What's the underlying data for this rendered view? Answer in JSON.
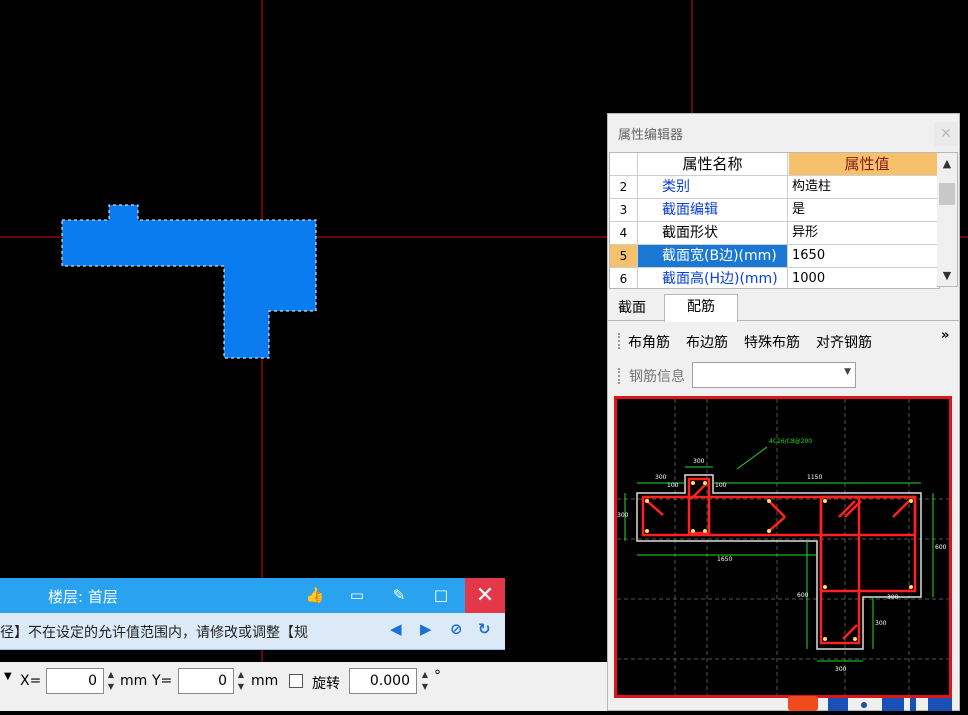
{
  "colors": {
    "canvas_bg": "#000000",
    "axis_line": "#cc1111",
    "column_fill": "#0a7cf0",
    "accent_blue": "#29a3f0",
    "selected_row": "#1a78d4",
    "header_value_bg": "#f5c26b",
    "close_red": "#e2384a",
    "rebar_red": "#ff2020",
    "dim_green": "#22dd22"
  },
  "property_editor": {
    "title": "属性编辑器",
    "close_icon": "close-icon",
    "columns": {
      "name": "属性名称",
      "value": "属性值"
    },
    "rows": [
      {
        "num": "2",
        "name": "类别",
        "value": "构造柱"
      },
      {
        "num": "3",
        "name": "截面编辑",
        "value": "是"
      },
      {
        "num": "4",
        "name": "截面形状",
        "value": "异形"
      },
      {
        "num": "5",
        "name": "截面宽(B边)(mm)",
        "value": "1650"
      },
      {
        "num": "6",
        "name": "截面高(H边)(mm)",
        "value": "1000"
      }
    ],
    "tabs": [
      "截面",
      "配筋"
    ],
    "rebar_tools": [
      "布角筋",
      "布边筋",
      "特殊布筋",
      "对齐钢筋"
    ],
    "more_symbol": "»",
    "rebar_info_label": "钢筋信息",
    "rebar_info_value": ""
  },
  "preview": {
    "dimensions": [
      "300",
      "300",
      "100",
      "100",
      "1150",
      "1650",
      "600",
      "600",
      "300",
      "300",
      "300",
      "300"
    ],
    "annotation": "4C16/C8@200"
  },
  "floor_bar": {
    "text": "楼层: 首层",
    "icons": [
      "thumbs-up-icon",
      "comment-icon",
      "edit-icon",
      "maximize-icon"
    ],
    "close_symbol": "✕"
  },
  "message_bar": {
    "text": "径】不在设定的允许值范围内，请修改或调整【规",
    "nav_prev": "◀",
    "nav_next": "▶",
    "cancel_symbol": "⊘",
    "refresh_symbol": "↻"
  },
  "status_bar": {
    "x_label": "X=",
    "x_value": "0",
    "x_unit": "mm",
    "y_label": "Y=",
    "y_value": "0",
    "y_unit": "mm",
    "rotate_label": "旋转",
    "rotate_value": "0.000",
    "degree": "°"
  }
}
